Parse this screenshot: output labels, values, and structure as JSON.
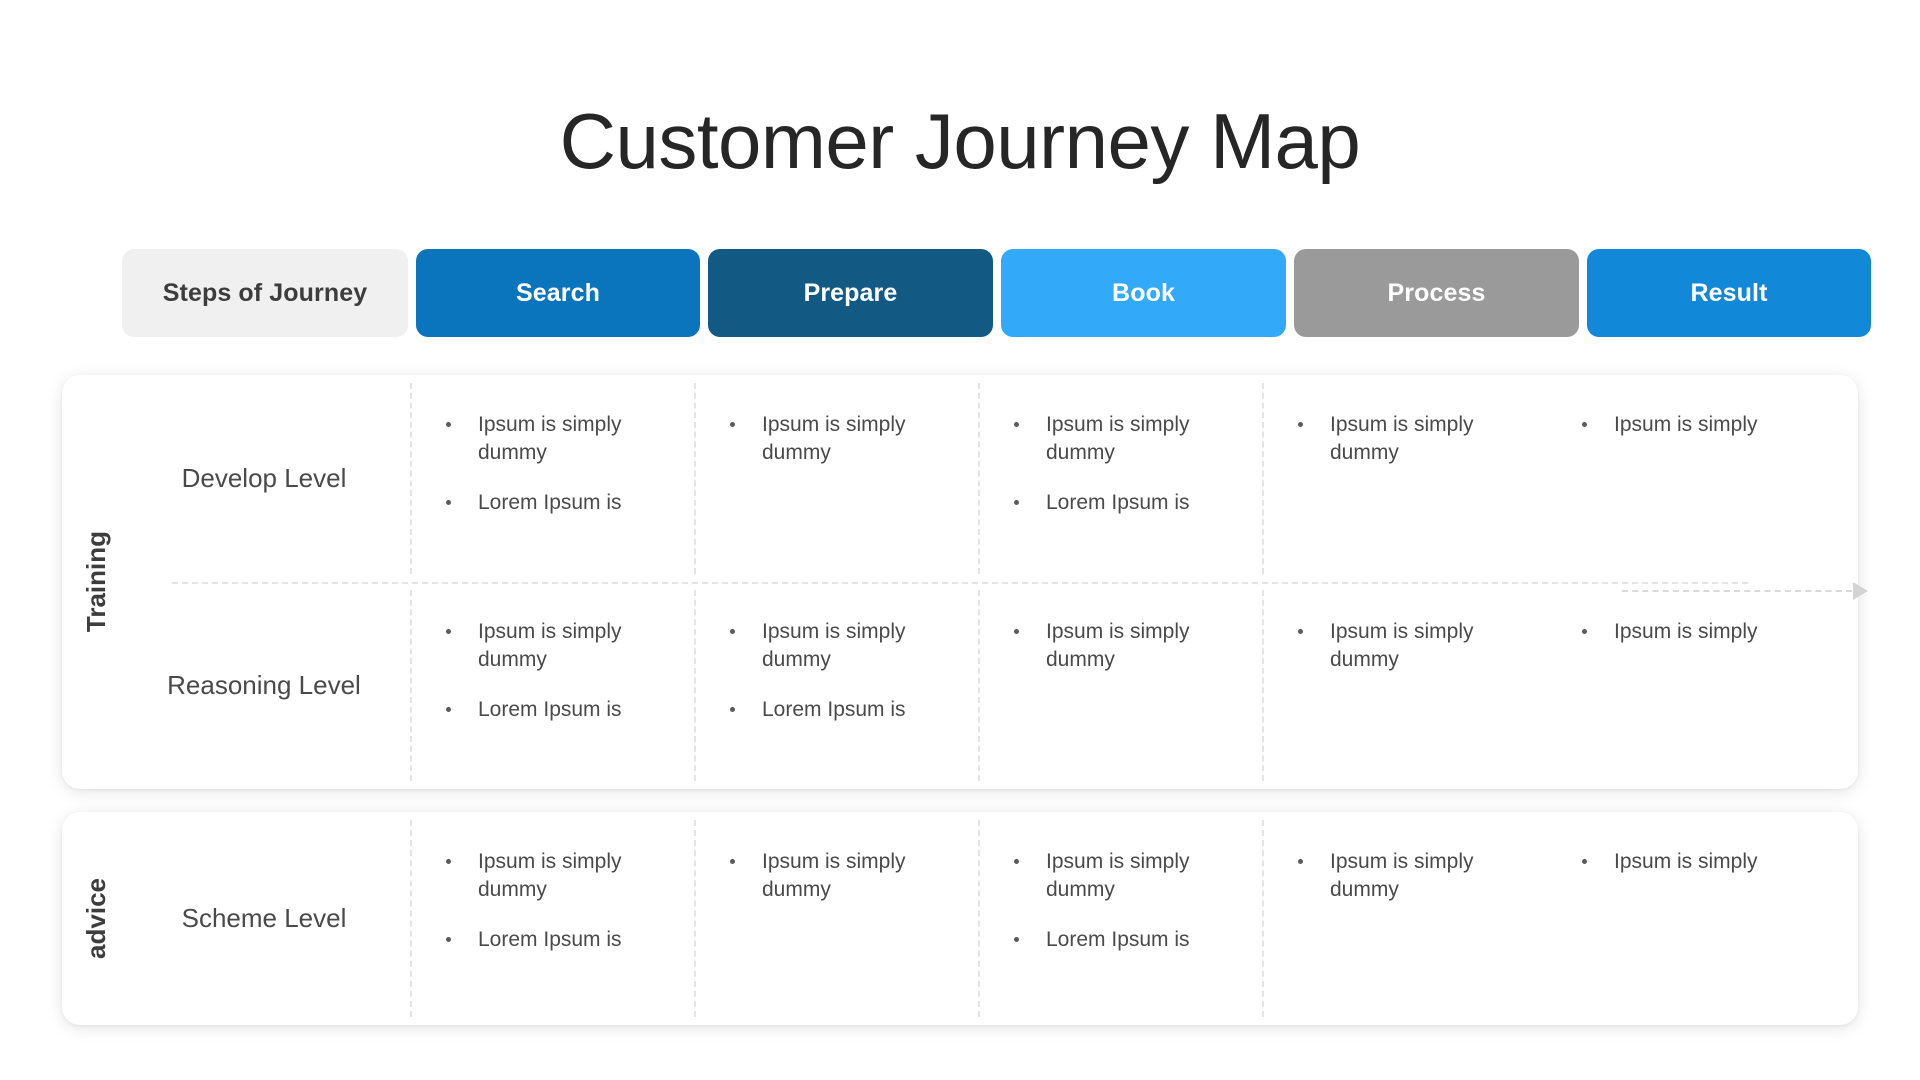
{
  "page": {
    "title": "Customer Journey Map",
    "background_color": "#ffffff"
  },
  "steps_header": {
    "label_cell": "Steps of Journey",
    "label_cell_bg": "#f0f0f0",
    "label_cell_color": "#3d3d3d",
    "steps": [
      {
        "label": "Search",
        "color": "#0a74bd"
      },
      {
        "label": "Prepare",
        "color": "#125a84"
      },
      {
        "label": "Book",
        "color": "#33aaf9"
      },
      {
        "label": "Process",
        "color": "#9a9a9a"
      },
      {
        "label": "Result",
        "color": "#1288d8"
      }
    ]
  },
  "arrow": {
    "name": "journey-direction-arrow",
    "color": "#d4d4d4"
  },
  "cards": [
    {
      "group_label": "Training",
      "rows": [
        {
          "row_label": "Develop Level",
          "cells": [
            {
              "bullets": [
                "Ipsum is simply dummy",
                "Lorem Ipsum is"
              ]
            },
            {
              "bullets": [
                "Ipsum is simply dummy"
              ]
            },
            {
              "bullets": [
                "Ipsum is simply dummy",
                "Lorem Ipsum is"
              ]
            },
            {
              "bullets": [
                "Ipsum is simply dummy"
              ]
            },
            {
              "bullets": [
                "Ipsum is simply"
              ]
            }
          ]
        },
        {
          "row_label": "Reasoning Level",
          "cells": [
            {
              "bullets": [
                "Ipsum is simply dummy",
                "Lorem Ipsum is"
              ]
            },
            {
              "bullets": [
                "Ipsum is simply dummy",
                "Lorem Ipsum is"
              ]
            },
            {
              "bullets": [
                "Ipsum is simply dummy"
              ]
            },
            {
              "bullets": [
                "Ipsum is simply dummy"
              ]
            },
            {
              "bullets": [
                "Ipsum is simply"
              ]
            }
          ]
        }
      ]
    },
    {
      "group_label": "advice",
      "rows": [
        {
          "row_label": "Scheme Level",
          "cells": [
            {
              "bullets": [
                "Ipsum is simply dummy",
                "Lorem Ipsum is"
              ]
            },
            {
              "bullets": [
                "Ipsum is simply dummy"
              ]
            },
            {
              "bullets": [
                "Ipsum is simply dummy",
                "Lorem Ipsum is"
              ]
            },
            {
              "bullets": [
                "Ipsum is simply dummy"
              ]
            },
            {
              "bullets": [
                "Ipsum is simply"
              ]
            }
          ]
        }
      ]
    }
  ]
}
